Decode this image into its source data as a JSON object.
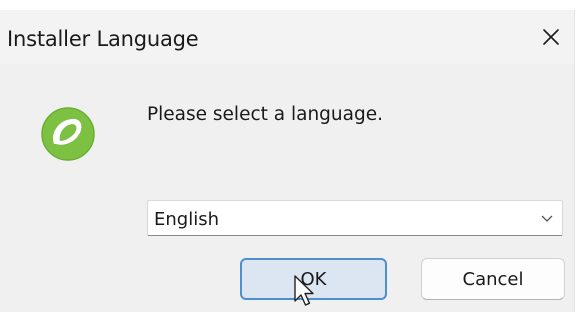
{
  "dialog": {
    "title": "Installer Language",
    "close_icon": "close-icon",
    "app_icon": "installer-logo-icon",
    "prompt": "Please select a language.",
    "language_select": {
      "value": "English",
      "icon": "chevron-down-icon"
    },
    "ok_label": "OK",
    "cancel_label": "Cancel"
  },
  "colors": {
    "window_bg": "#f0f0f0",
    "accent_border": "#4e8fd0",
    "ok_bg": "#dbe6f2",
    "logo_green": "#7cc142"
  }
}
